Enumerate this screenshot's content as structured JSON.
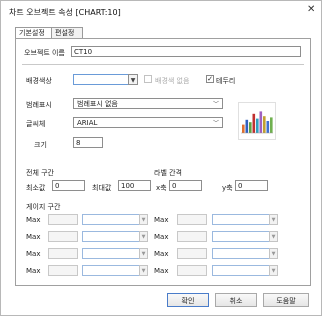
{
  "window": {
    "title": "차트 오브젝트 속성 [CHART:10]",
    "close_icon": "✕"
  },
  "tabs": [
    {
      "label": "기본설정"
    },
    {
      "label": "편설정"
    }
  ],
  "object_name": {
    "label": "오브젝트 이름",
    "value": "CT10"
  },
  "background": {
    "label": "배경색상",
    "value": "",
    "no_bg_label": "배경색 없음",
    "no_bg_checked": false,
    "border_label": "테두리",
    "border_checked": true
  },
  "legend": {
    "label": "범례표시",
    "value": "범례표시 없음"
  },
  "font": {
    "label": "글씨체",
    "value": "ARIAL"
  },
  "size": {
    "label": "크기",
    "value": "8"
  },
  "range": {
    "label": "전체 구간",
    "min_label": "최소값",
    "min_value": "0",
    "max_label": "최대값",
    "max_value": "100"
  },
  "label_interval": {
    "label": "라벨 간격",
    "x_label": "x축",
    "x_value": "0",
    "y_label": "y축",
    "y_value": "0"
  },
  "gauge": {
    "label": "게이지 구간",
    "rows": [
      {
        "left": "Max",
        "right": "Max"
      },
      {
        "left": "Max",
        "right": "Max"
      },
      {
        "left": "Max",
        "right": "Max"
      },
      {
        "left": "Max",
        "right": "Max"
      }
    ]
  },
  "buttons": {
    "ok": "확인",
    "cancel": "취소",
    "help": "도움말"
  },
  "preview_bar_colors": [
    "#e07030",
    "#3060c0",
    "#60a040",
    "#c03030",
    "#30a0c0",
    "#a060c0",
    "#c0a030",
    "#4070d0",
    "#70b050"
  ],
  "preview_bar_values": [
    0.35,
    0.55,
    0.45,
    0.8,
    0.6,
    0.9,
    0.7,
    0.5,
    0.65
  ],
  "icons": {
    "dropdown": "chevron-down-icon",
    "close": "close-icon"
  }
}
